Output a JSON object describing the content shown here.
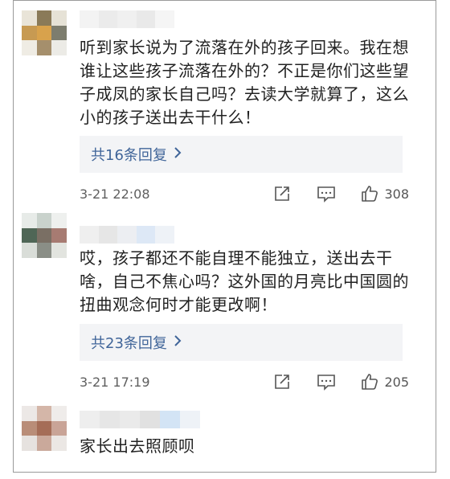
{
  "comments": [
    {
      "text": "听到家长说为了流落在外的孩子回来。我在想谁让这些孩子流落在外的？不正是你们这些望子成凤的家长自己吗？去读大学就算了，这么小的孩子送出去干什么！",
      "reply_label": "共16条回复",
      "date": "3-21 22:08",
      "likes": "308"
    },
    {
      "text": "哎，孩子都还不能自理不能独立，送出去干啥，自己不焦心吗？这外国的月亮比中国圆的扭曲观念何时才能更改啊！",
      "reply_label": "共23条回复",
      "date": "3-21 17:19",
      "likes": "205"
    },
    {
      "text": "家长出去照顾呗"
    }
  ],
  "icons": {
    "reply_chevron": "chevron-right-icon",
    "share": "share-icon",
    "comment": "comment-icon",
    "like": "thumbs-up-icon"
  },
  "colors": {
    "link": "#406599",
    "reply_bg": "#f3f4f6",
    "text": "#222222",
    "meta": "#666666"
  }
}
